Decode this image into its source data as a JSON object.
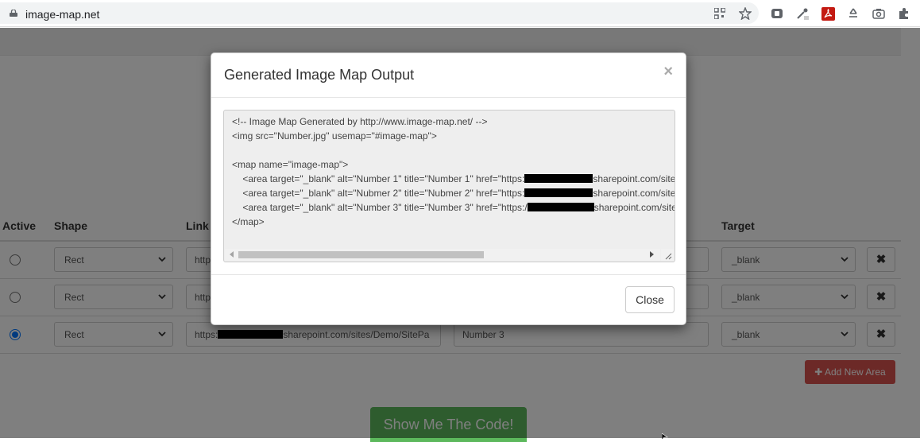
{
  "browser": {
    "url": "image-map.net",
    "icons": [
      "qr-code-icon",
      "star-icon",
      "extension-icon",
      "eyedropper-icon",
      "pdf-icon",
      "recycle-icon",
      "camera-icon",
      "puzzle-icon"
    ]
  },
  "table": {
    "headers": {
      "active": "Active",
      "shape": "Shape",
      "link": "Link",
      "target": "Target"
    },
    "rows": [
      {
        "shape": "Rect",
        "link_visible": "http",
        "title": "",
        "target": "_blank",
        "checked": false
      },
      {
        "shape": "Rect",
        "link_visible": "http",
        "title": "",
        "target": "_blank",
        "checked": false
      },
      {
        "shape": "Rect",
        "link_prefix": "https:",
        "link_suffix": "sharepoint.com/sites/Demo/SitePa",
        "title": "Number 3",
        "target": "_blank",
        "checked": true
      }
    ],
    "add_button": "Add New Area",
    "delete_glyph": "✖"
  },
  "show_code_button": "Show Me The Code!",
  "modal": {
    "title": "Generated Image Map Output",
    "close_x": "×",
    "code_lines": [
      "<!-- Image Map Generated by http://www.image-map.net/ -->",
      "<img src=\"Number.jpg\" usemap=\"#image-map\">",
      "",
      "<map name=\"image-map\">",
      "    <area target=\"_blank\" alt=\"Number 1\" title=\"Number 1\" href=\"https:",
      "    <area target=\"_blank\" alt=\"Nubmer 2\" title=\"Nubmer 2\" href=\"https:",
      "    <area target=\"_blank\" alt=\"Number 3\" title=\"Number 3\" href=\"https:/",
      "</map>"
    ],
    "code_suffix": "sharepoint.com/site",
    "close_button": "Close"
  },
  "colors": {
    "danger": "#d9534f",
    "success": "#5cb85c",
    "radio_checked": "#0075ff"
  }
}
